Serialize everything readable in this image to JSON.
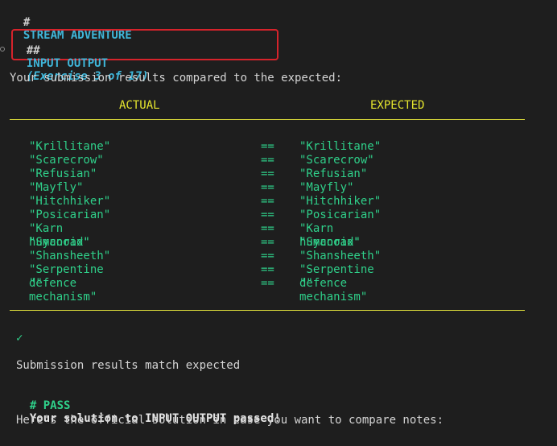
{
  "heading": {
    "hash": "#",
    "title": "STREAM ADVENTURE"
  },
  "exercise": {
    "hash": "##",
    "title": "INPUT OUTPUT",
    "detail": "(Exercise 3 of 17)"
  },
  "intro": "Your submission results compared to the expected:",
  "columns": {
    "actual": "ACTUAL",
    "expected": "EXPECTED"
  },
  "rows": [
    {
      "actual": "\"Krillitane\"",
      "op": "==",
      "expected": "\"Krillitane\""
    },
    {
      "actual": "\"Scarecrow\"",
      "op": "==",
      "expected": "\"Scarecrow\""
    },
    {
      "actual": "\"Refusian\"",
      "op": "==",
      "expected": "\"Refusian\""
    },
    {
      "actual": "\"Mayfly\"",
      "op": "==",
      "expected": "\"Mayfly\""
    },
    {
      "actual": "\"Hitchhiker\"",
      "op": "==",
      "expected": "\"Hitchhiker\""
    },
    {
      "actual": "\"Posicarian\"",
      "op": "==",
      "expected": "\"Posicarian\""
    },
    {
      "actual": "\"Karn humanoid\"",
      "op": "==",
      "expected": "\"Karn humanoid\""
    },
    {
      "actual": "\"Sycorax\"",
      "op": "==",
      "expected": "\"Sycorax\""
    },
    {
      "actual": "\"Shansheeth\"",
      "op": "==",
      "expected": "\"Shansheeth\""
    },
    {
      "actual": "\"Serpentine defence mechanism\"",
      "op": "==",
      "expected": "\"Serpentine defence mechanism\""
    },
    {
      "actual": "\"\"",
      "op": "==",
      "expected": "\"\""
    }
  ],
  "check": "✓",
  "match_text": "Submission results match expected",
  "pass": {
    "hash": "# PASS",
    "text": "Your solution to INPUT OUTPUT passed!"
  },
  "footer": "Here's the official solution in case you want to compare notes:",
  "colors": {
    "accent": "#3fb6d9",
    "match": "#2fd08a",
    "rule": "#d8d83a",
    "highlight": "#d6232b"
  }
}
